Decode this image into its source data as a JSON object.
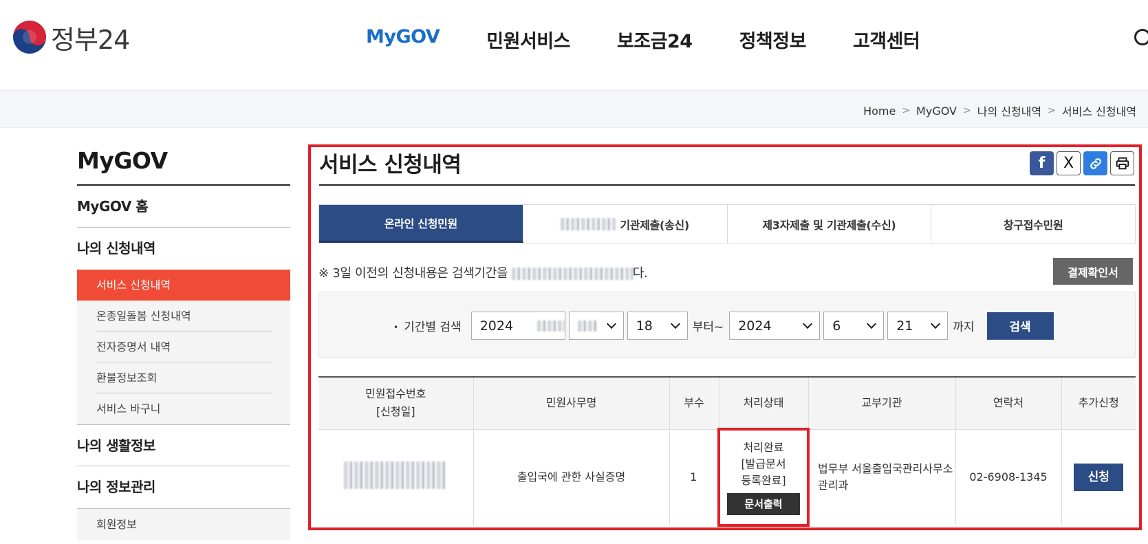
{
  "header": {
    "logo_text": "정부24",
    "nav": [
      "MyGOV",
      "민원서비스",
      "보조금24",
      "정책정보",
      "고객센터"
    ]
  },
  "breadcrumb": [
    "Home",
    "MyGOV",
    "나의 신청내역",
    "서비스 신청내역"
  ],
  "sidebar": {
    "title": "MyGOV",
    "home": "MyGOV 홈",
    "group1": "나의 신청내역",
    "group1_items": [
      "서비스 신청내역",
      "온종일돌봄 신청내역",
      "전자증명서 내역",
      "환불정보조회",
      "서비스 바구니"
    ],
    "group2": "나의 생활정보",
    "group3": "나의 정보관리",
    "group3_items": [
      "회원정보"
    ]
  },
  "main": {
    "title": "서비스 신청내역",
    "share": {
      "facebook": "f",
      "x": "X",
      "link": "🔗"
    },
    "tabs": [
      "온라인 신청민원",
      "기관제출(송신)",
      "제3자제출 및 기관제출(수신)",
      "창구접수민원"
    ],
    "notice": "※ 3일 이전의 신청내용은 검색기간을 ",
    "notice_end": "다.",
    "receipt_button": "결제확인서",
    "search": {
      "label": "기간별 검색",
      "from_year": "2024",
      "from_day": "18",
      "from_suffix": "부터~",
      "to_year": "2024",
      "to_month": "6",
      "to_day": "21",
      "to_suffix": "까지",
      "button": "검색"
    },
    "table": {
      "headers": [
        "민원접수번호",
        "[신청일]",
        "민원사무명",
        "부수",
        "처리상태",
        "교부기관",
        "연락처",
        "추가신청"
      ],
      "row": {
        "service_name": "출입국에 관한 사실증명",
        "copies": "1",
        "status_line1": "처리완료",
        "status_line2": "[발급문서",
        "status_line3": "등록완료]",
        "print_button": "문서출력",
        "org_line1": "법무부 서울출입국관리사무소",
        "org_line2": "관리과",
        "phone": "02-6908-1345",
        "apply_button": "신청"
      }
    }
  }
}
